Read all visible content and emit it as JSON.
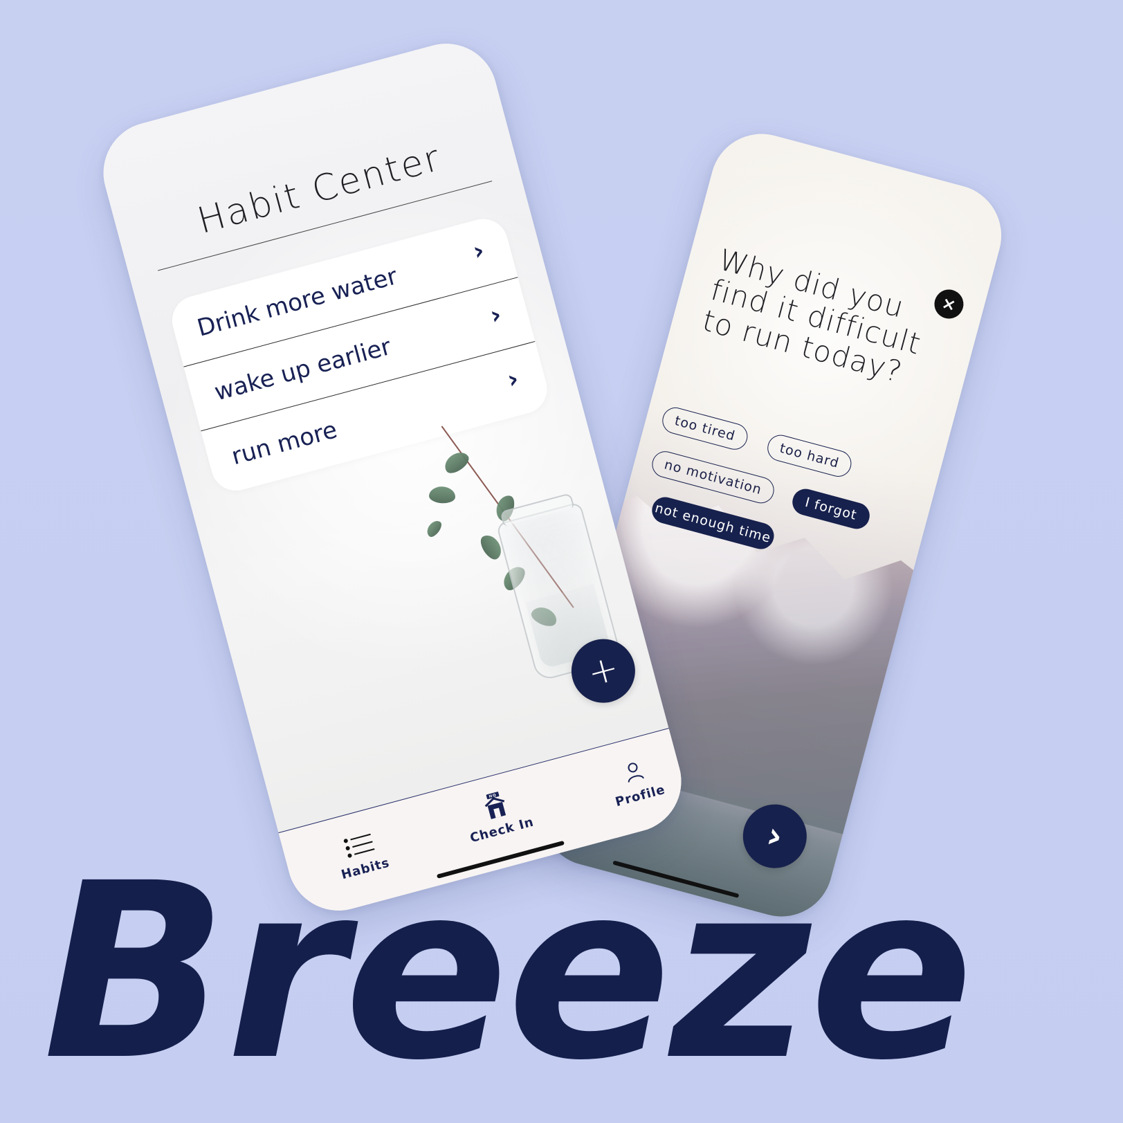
{
  "brand": {
    "name": "Breeze"
  },
  "left_phone": {
    "title": "Habit Center",
    "habits": [
      {
        "label": "Drink more water"
      },
      {
        "label": "wake up earlier"
      },
      {
        "label": "run more"
      }
    ],
    "tabs": [
      {
        "label": "Habits"
      },
      {
        "label": "Check In"
      },
      {
        "label": "Profile"
      }
    ],
    "icons": {
      "chevron": "chevron-right-icon",
      "add": "plus-icon",
      "habits": "list-icon",
      "checkin": "hq-house-icon",
      "profile": "user-icon"
    },
    "checkin_badge": "HQ"
  },
  "right_phone": {
    "question": "Why did you find it difficult to run today?",
    "options": [
      {
        "label": "too tired"
      },
      {
        "label": "too hard"
      },
      {
        "label": "no motivation"
      },
      {
        "label": "I forgot"
      },
      {
        "label": "not enough time"
      }
    ],
    "icons": {
      "close": "close-icon",
      "next": "chevron-right-icon"
    }
  },
  "colors": {
    "background": "#c7d0f2",
    "navy": "#17214d",
    "text_dark": "#1f1f24",
    "white": "#ffffff"
  }
}
